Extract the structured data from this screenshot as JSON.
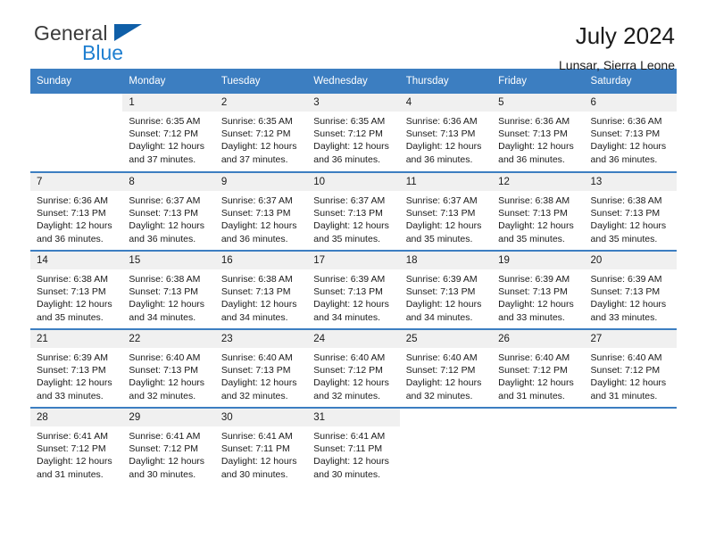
{
  "brand": {
    "name_part1": "General",
    "name_part2": "Blue",
    "flag_icon": "triangle-flag-icon"
  },
  "header": {
    "title": "July 2024",
    "subtitle": "Lunsar, Sierra Leone"
  },
  "colors": {
    "header_blue": "#3c7ec1",
    "brand_blue": "#1f7fd0",
    "flag_blue": "#0f5fa8",
    "daynum_band": "#f0f0f0",
    "text": "#1a1a1a"
  },
  "calendar": {
    "weekday_headers": [
      "Sunday",
      "Monday",
      "Tuesday",
      "Wednesday",
      "Thursday",
      "Friday",
      "Saturday"
    ],
    "weeks": [
      [
        {
          "day": "",
          "blank": true,
          "lines": []
        },
        {
          "day": "1",
          "lines": [
            "Sunrise: 6:35 AM",
            "Sunset: 7:12 PM",
            "Daylight: 12 hours",
            "and 37 minutes."
          ]
        },
        {
          "day": "2",
          "lines": [
            "Sunrise: 6:35 AM",
            "Sunset: 7:12 PM",
            "Daylight: 12 hours",
            "and 37 minutes."
          ]
        },
        {
          "day": "3",
          "lines": [
            "Sunrise: 6:35 AM",
            "Sunset: 7:12 PM",
            "Daylight: 12 hours",
            "and 36 minutes."
          ]
        },
        {
          "day": "4",
          "lines": [
            "Sunrise: 6:36 AM",
            "Sunset: 7:13 PM",
            "Daylight: 12 hours",
            "and 36 minutes."
          ]
        },
        {
          "day": "5",
          "lines": [
            "Sunrise: 6:36 AM",
            "Sunset: 7:13 PM",
            "Daylight: 12 hours",
            "and 36 minutes."
          ]
        },
        {
          "day": "6",
          "lines": [
            "Sunrise: 6:36 AM",
            "Sunset: 7:13 PM",
            "Daylight: 12 hours",
            "and 36 minutes."
          ]
        }
      ],
      [
        {
          "day": "7",
          "lines": [
            "Sunrise: 6:36 AM",
            "Sunset: 7:13 PM",
            "Daylight: 12 hours",
            "and 36 minutes."
          ]
        },
        {
          "day": "8",
          "lines": [
            "Sunrise: 6:37 AM",
            "Sunset: 7:13 PM",
            "Daylight: 12 hours",
            "and 36 minutes."
          ]
        },
        {
          "day": "9",
          "lines": [
            "Sunrise: 6:37 AM",
            "Sunset: 7:13 PM",
            "Daylight: 12 hours",
            "and 36 minutes."
          ]
        },
        {
          "day": "10",
          "lines": [
            "Sunrise: 6:37 AM",
            "Sunset: 7:13 PM",
            "Daylight: 12 hours",
            "and 35 minutes."
          ]
        },
        {
          "day": "11",
          "lines": [
            "Sunrise: 6:37 AM",
            "Sunset: 7:13 PM",
            "Daylight: 12 hours",
            "and 35 minutes."
          ]
        },
        {
          "day": "12",
          "lines": [
            "Sunrise: 6:38 AM",
            "Sunset: 7:13 PM",
            "Daylight: 12 hours",
            "and 35 minutes."
          ]
        },
        {
          "day": "13",
          "lines": [
            "Sunrise: 6:38 AM",
            "Sunset: 7:13 PM",
            "Daylight: 12 hours",
            "and 35 minutes."
          ]
        }
      ],
      [
        {
          "day": "14",
          "lines": [
            "Sunrise: 6:38 AM",
            "Sunset: 7:13 PM",
            "Daylight: 12 hours",
            "and 35 minutes."
          ]
        },
        {
          "day": "15",
          "lines": [
            "Sunrise: 6:38 AM",
            "Sunset: 7:13 PM",
            "Daylight: 12 hours",
            "and 34 minutes."
          ]
        },
        {
          "day": "16",
          "lines": [
            "Sunrise: 6:38 AM",
            "Sunset: 7:13 PM",
            "Daylight: 12 hours",
            "and 34 minutes."
          ]
        },
        {
          "day": "17",
          "lines": [
            "Sunrise: 6:39 AM",
            "Sunset: 7:13 PM",
            "Daylight: 12 hours",
            "and 34 minutes."
          ]
        },
        {
          "day": "18",
          "lines": [
            "Sunrise: 6:39 AM",
            "Sunset: 7:13 PM",
            "Daylight: 12 hours",
            "and 34 minutes."
          ]
        },
        {
          "day": "19",
          "lines": [
            "Sunrise: 6:39 AM",
            "Sunset: 7:13 PM",
            "Daylight: 12 hours",
            "and 33 minutes."
          ]
        },
        {
          "day": "20",
          "lines": [
            "Sunrise: 6:39 AM",
            "Sunset: 7:13 PM",
            "Daylight: 12 hours",
            "and 33 minutes."
          ]
        }
      ],
      [
        {
          "day": "21",
          "lines": [
            "Sunrise: 6:39 AM",
            "Sunset: 7:13 PM",
            "Daylight: 12 hours",
            "and 33 minutes."
          ]
        },
        {
          "day": "22",
          "lines": [
            "Sunrise: 6:40 AM",
            "Sunset: 7:13 PM",
            "Daylight: 12 hours",
            "and 32 minutes."
          ]
        },
        {
          "day": "23",
          "lines": [
            "Sunrise: 6:40 AM",
            "Sunset: 7:13 PM",
            "Daylight: 12 hours",
            "and 32 minutes."
          ]
        },
        {
          "day": "24",
          "lines": [
            "Sunrise: 6:40 AM",
            "Sunset: 7:12 PM",
            "Daylight: 12 hours",
            "and 32 minutes."
          ]
        },
        {
          "day": "25",
          "lines": [
            "Sunrise: 6:40 AM",
            "Sunset: 7:12 PM",
            "Daylight: 12 hours",
            "and 32 minutes."
          ]
        },
        {
          "day": "26",
          "lines": [
            "Sunrise: 6:40 AM",
            "Sunset: 7:12 PM",
            "Daylight: 12 hours",
            "and 31 minutes."
          ]
        },
        {
          "day": "27",
          "lines": [
            "Sunrise: 6:40 AM",
            "Sunset: 7:12 PM",
            "Daylight: 12 hours",
            "and 31 minutes."
          ]
        }
      ],
      [
        {
          "day": "28",
          "lines": [
            "Sunrise: 6:41 AM",
            "Sunset: 7:12 PM",
            "Daylight: 12 hours",
            "and 31 minutes."
          ]
        },
        {
          "day": "29",
          "lines": [
            "Sunrise: 6:41 AM",
            "Sunset: 7:12 PM",
            "Daylight: 12 hours",
            "and 30 minutes."
          ]
        },
        {
          "day": "30",
          "lines": [
            "Sunrise: 6:41 AM",
            "Sunset: 7:11 PM",
            "Daylight: 12 hours",
            "and 30 minutes."
          ]
        },
        {
          "day": "31",
          "lines": [
            "Sunrise: 6:41 AM",
            "Sunset: 7:11 PM",
            "Daylight: 12 hours",
            "and 30 minutes."
          ]
        },
        {
          "day": "",
          "blank": true,
          "lines": []
        },
        {
          "day": "",
          "blank": true,
          "lines": []
        },
        {
          "day": "",
          "blank": true,
          "lines": []
        }
      ]
    ]
  }
}
